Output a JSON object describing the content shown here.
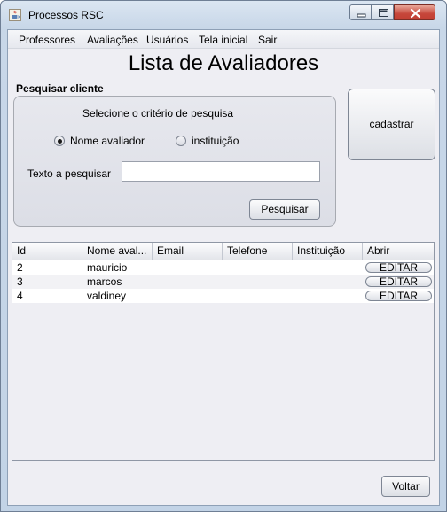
{
  "window": {
    "title": "Processos RSC"
  },
  "menu": [
    "Professores",
    "Avaliações",
    "Usuários",
    "Tela inicial",
    "Sair"
  ],
  "heading": "Lista de Avaliadores",
  "search": {
    "section_label": "Pesquisar cliente",
    "criteria_label": "Selecione o critério de pesquisa",
    "options": [
      {
        "label": "Nome avaliador",
        "checked": true
      },
      {
        "label": "instituição",
        "checked": false
      }
    ],
    "text_label": "Texto a pesquisar",
    "input_value": "",
    "button_label": "Pesquisar"
  },
  "register_button": "cadastrar",
  "table": {
    "columns": [
      "Id",
      "Nome aval...",
      "Email",
      "Telefone",
      "Instituição",
      "Abrir"
    ],
    "rows": [
      {
        "id": "2",
        "nome": "mauricio",
        "email": "",
        "telefone": "",
        "instituicao": "",
        "abrir": "EDITAR"
      },
      {
        "id": "3",
        "nome": "marcos",
        "email": "",
        "telefone": "",
        "instituicao": "",
        "abrir": "EDITAR"
      },
      {
        "id": "4",
        "nome": "valdiney",
        "email": "",
        "telefone": "",
        "instituicao": "",
        "abrir": "EDITAR"
      }
    ]
  },
  "back_button": "Voltar",
  "icons": {
    "app": "java-cup-icon",
    "minimize": "minimize-icon",
    "maximize": "maximize-icon",
    "close": "close-icon"
  },
  "colors": {
    "close_button": "#c6463a",
    "window_frame": "#c2d3e6",
    "content_bg": "#eeeef3"
  }
}
